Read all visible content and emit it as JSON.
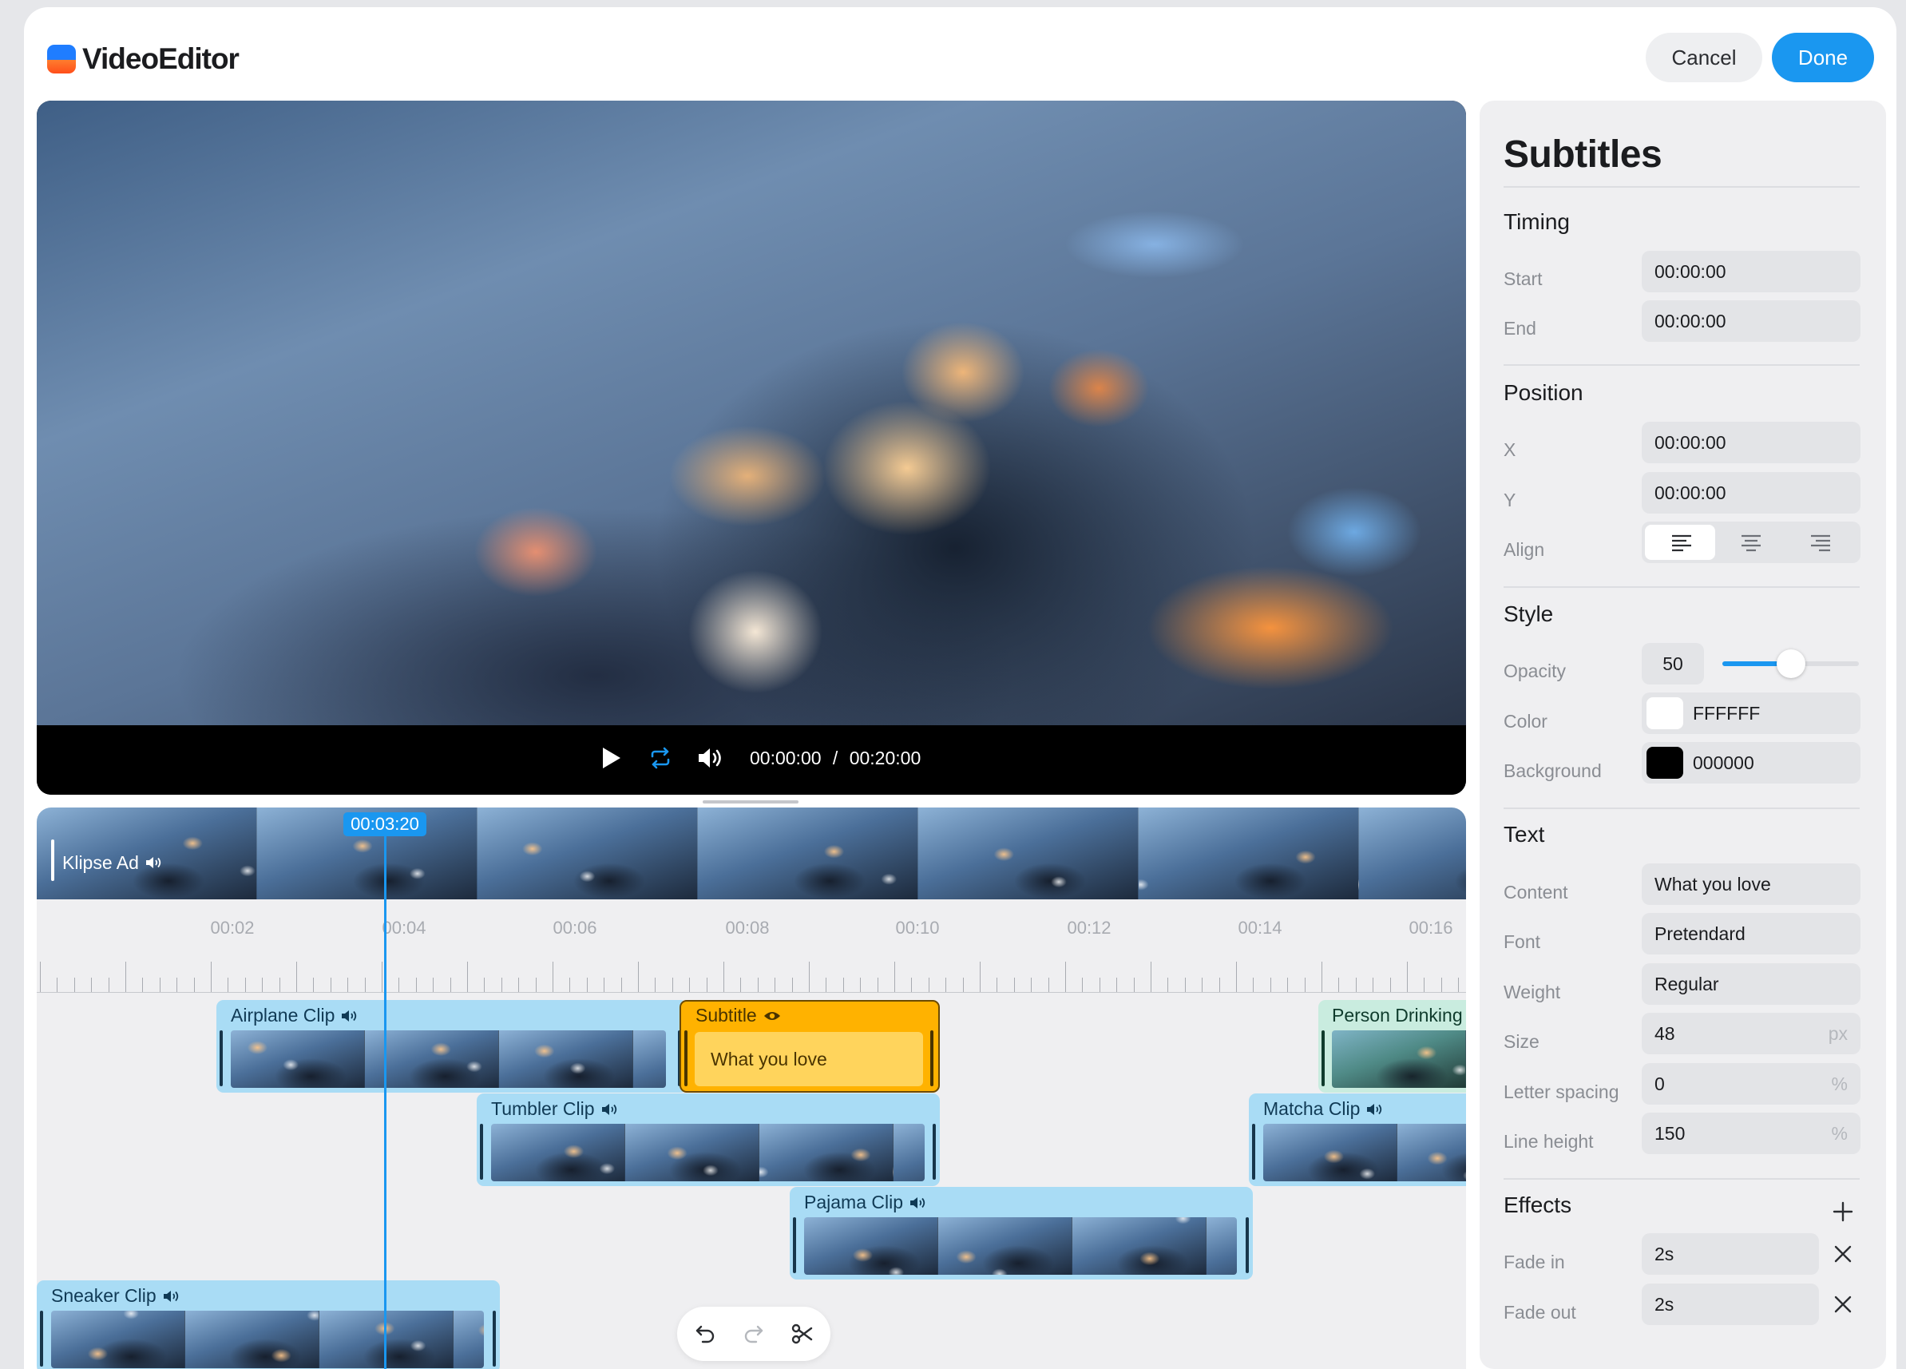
{
  "app": {
    "name": "VideoEditor",
    "cancel_label": "Cancel",
    "done_label": "Done"
  },
  "player": {
    "current_time": "00:00:00",
    "separator": "/",
    "total_time": "00:20:00",
    "icons": [
      "play-icon",
      "loop-icon",
      "volume-icon"
    ]
  },
  "timeline": {
    "playhead": "00:03:20",
    "main_track_label": "Klipse Ad",
    "ruler": [
      "00:02",
      "00:04",
      "00:06",
      "00:08",
      "00:10",
      "00:12",
      "00:14",
      "00:16"
    ],
    "clips": {
      "airplane": "Airplane Clip",
      "subtitle": "Subtitle",
      "subtitle_text": "What you love",
      "person": "Person Drinking M",
      "tumbler": "Tumbler Clip",
      "matcha": "Matcha Clip",
      "pajama": "Pajama Clip",
      "sneaker": "Sneaker Clip"
    },
    "toolbar": [
      "undo-icon",
      "redo-icon",
      "scissors-icon"
    ]
  },
  "panel": {
    "title": "Subtitles",
    "timing": {
      "title": "Timing",
      "start_label": "Start",
      "start_value": "00:00:00",
      "end_label": "End",
      "end_value": "00:00:00"
    },
    "position": {
      "title": "Position",
      "x_label": "X",
      "x_value": "00:00:00",
      "y_label": "Y",
      "y_value": "00:00:00",
      "align_label": "Align",
      "align_selected": "left"
    },
    "style": {
      "title": "Style",
      "opacity_label": "Opacity",
      "opacity_value": "50",
      "opacity_level": 0.5,
      "color_label": "Color",
      "color_value": "FFFFFF",
      "background_label": "Background",
      "background_value": "000000"
    },
    "text": {
      "title": "Text",
      "content_label": "Content",
      "content_value": "What you love",
      "font_label": "Font",
      "font_value": "Pretendard",
      "weight_label": "Weight",
      "weight_value": "Regular",
      "size_label": "Size",
      "size_value": "48",
      "size_unit": "px",
      "letter_spacing_label": "Letter spacing",
      "letter_spacing_value": "0",
      "letter_spacing_unit": "%",
      "line_height_label": "Line height",
      "line_height_value": "150",
      "line_height_unit": "%"
    },
    "effects": {
      "title": "Effects",
      "fade_in_label": "Fade in",
      "fade_in_value": "2s",
      "fade_out_label": "Fade out",
      "fade_out_value": "2s"
    }
  },
  "colors": {
    "accent": "#1a97f0",
    "clip": "#a9dcf5",
    "subtitle_clip": "#ffb200",
    "panel_bg": "#efeff1"
  }
}
